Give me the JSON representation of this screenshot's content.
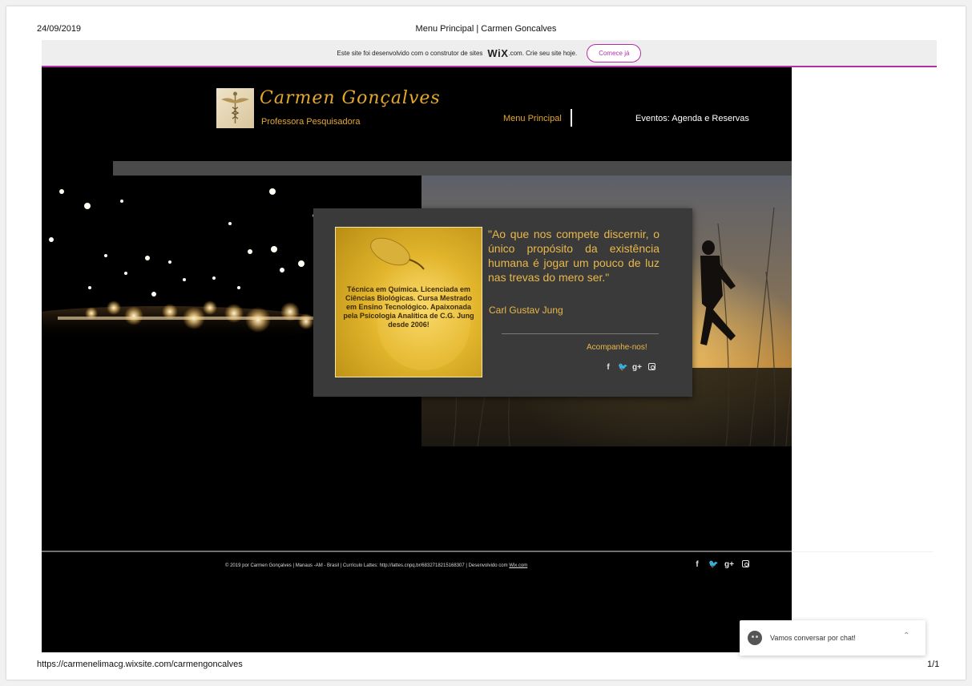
{
  "print_header": {
    "date": "24/09/2019",
    "title": "Menu Principal | Carmen Goncalves"
  },
  "print_footer": {
    "url": "https://carmenelimacg.wixsite.com/carmengoncalves",
    "page": "1/1"
  },
  "wix_banner": {
    "text_before": "Este site foi desenvolvido com o construtor de sites",
    "logo": "WiX",
    "text_after": ".com. Crie seu site hoje.",
    "button": "Comece já"
  },
  "site": {
    "name": "Carmen Gonçalves",
    "subtitle": "Professora Pesquisadora",
    "nav": [
      "Menu Principal",
      "Eventos: Agenda e Reservas"
    ]
  },
  "card": {
    "image_text": "Técnica em Química. Licenciada em Ciências Biológicas. Cursa Mestrado em Ensino Tecnológico. Apaixonada pela Psicologia Analítica de C.G. Jung desde 2006!",
    "quote": "\"Ao que nos compete discernir, o único propósito da existência humana é jogar um pouco de luz nas trevas do mero ser.\"",
    "author": "Carl Gustav Jung",
    "follow": "Acompanhe-nos!"
  },
  "social": {
    "facebook": "f",
    "twitter": "🐦",
    "googleplus": "g+"
  },
  "footer": {
    "text": "© 2019 por Carmen Gonçalves  |  Manaus -AM - Brasil  |  Currículo Lattes:  http://lattes.cnpq.br/6832718215168307  |  Desenvolvido com ",
    "link": "Wix.com"
  },
  "chat": {
    "label": "Vamos conversar por chat!"
  },
  "colors": {
    "gold": "#e5a82a",
    "wix_accent": "#b22fa6",
    "card_bg": "#3a3a3a"
  }
}
